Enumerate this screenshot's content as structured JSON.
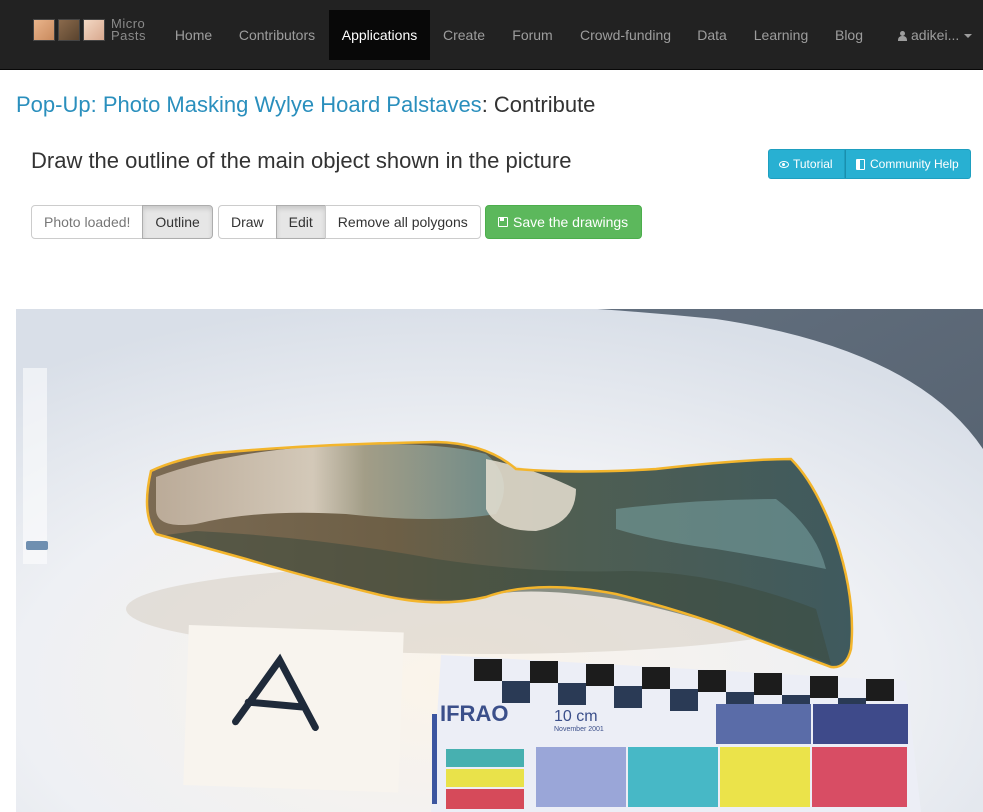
{
  "navbar": {
    "brand_text": "Micro Pasts",
    "items": [
      {
        "label": "Home",
        "active": false
      },
      {
        "label": "Contributors",
        "active": false
      },
      {
        "label": "Applications",
        "active": true
      },
      {
        "label": "Create",
        "active": false
      },
      {
        "label": "Forum",
        "active": false
      },
      {
        "label": "Crowd-funding",
        "active": false
      },
      {
        "label": "Data",
        "active": false
      },
      {
        "label": "Learning",
        "active": false
      },
      {
        "label": "Blog",
        "active": false
      }
    ],
    "user_label": "adikei..."
  },
  "page": {
    "project_link": "Pop-Up: Photo Masking Wylye Hoard Palstaves",
    "title_suffix": ": Contribute",
    "question": "Draw the outline of the main object shown in the picture"
  },
  "help": {
    "tutorial_label": "Tutorial",
    "community_label": "Community Help"
  },
  "toolbar": {
    "status_label": "Photo loaded!",
    "outline_label": "Outline",
    "draw_label": "Draw",
    "edit_label": "Edit",
    "remove_label": "Remove all polygons",
    "save_label": "Save the drawings"
  },
  "photo": {
    "card_letter": "A",
    "scale_brand": "IFRAO",
    "scale_length": "10 cm",
    "scale_date": "November 2001",
    "outline_color": "#f3b52c"
  },
  "colors": {
    "navbar_bg": "#222222",
    "link": "#2a8fbd",
    "info_button": "#28b0d2",
    "success_button": "#5cb85c"
  }
}
